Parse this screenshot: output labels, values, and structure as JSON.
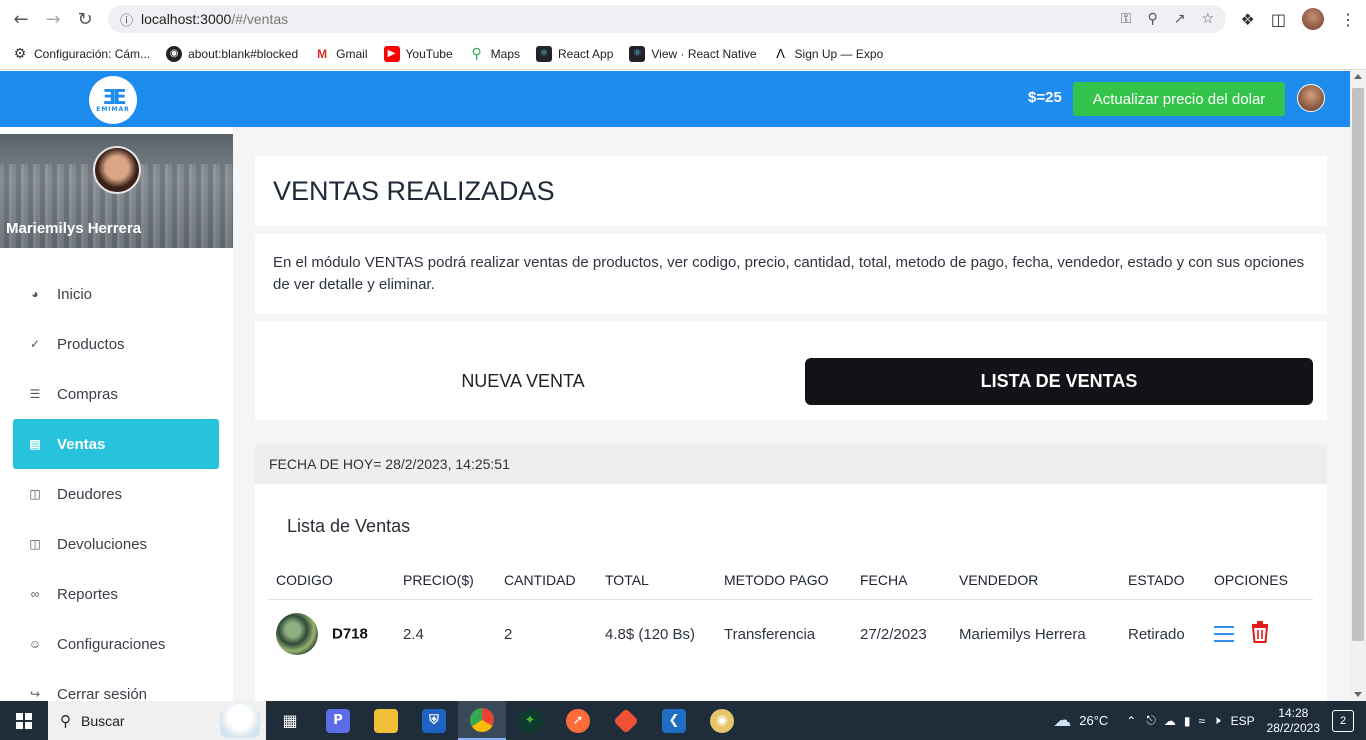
{
  "browser": {
    "url_host": "localhost:3000",
    "url_path": "/#/ventas",
    "bookmarks": [
      {
        "label": "Configuración: Cám...",
        "icon": "gear-icon"
      },
      {
        "label": "about:blank#blocked",
        "icon": "globe-icon"
      },
      {
        "label": "Gmail",
        "icon": "gmail-icon"
      },
      {
        "label": "YouTube",
        "icon": "youtube-icon"
      },
      {
        "label": "Maps",
        "icon": "maps-icon"
      },
      {
        "label": "React App",
        "icon": "react-icon"
      },
      {
        "label": "View · React Native",
        "icon": "react-icon"
      },
      {
        "label": "Sign Up — Expo",
        "icon": "expo-icon"
      }
    ]
  },
  "header": {
    "logo_mark": "ƎE",
    "logo_text": "EMIMAR",
    "rate": "$=25",
    "update_button": "Actualizar precio del dolar",
    "brand_color": "#1e8bef",
    "button_color": "#34c34b"
  },
  "sidebar": {
    "user_name": "Mariemilys Herrera",
    "items": [
      {
        "label": "Inicio",
        "icon": "dashboard-icon"
      },
      {
        "label": "Productos",
        "icon": "check-circle-icon"
      },
      {
        "label": "Compras",
        "icon": "list-icon"
      },
      {
        "label": "Ventas",
        "icon": "document-icon",
        "active": true
      },
      {
        "label": "Deudores",
        "icon": "columns-icon"
      },
      {
        "label": "Devoluciones",
        "icon": "book-icon"
      },
      {
        "label": "Reportes",
        "icon": "link-icon"
      },
      {
        "label": "Configuraciones",
        "icon": "users-icon"
      },
      {
        "label": "Cerrar sesión",
        "icon": "logout-icon"
      }
    ],
    "active_color": "#27c2dc"
  },
  "main": {
    "title": "VENTAS REALIZADAS",
    "description": "En el módulo VENTAS podrá realizar ventas de productos, ver codigo, precio, cantidad, total, metodo de pago, fecha, vendedor, estado y con sus opciones de ver detalle y eliminar.",
    "tab_new": "NUEVA VENTA",
    "tab_list": "LISTA DE VENTAS",
    "date_label": "FECHA DE HOY= 28/2/2023, 14:25:51",
    "list_title": "Lista de Ventas",
    "columns": [
      "CODIGO",
      "PRECIO($)",
      "CANTIDAD",
      "TOTAL",
      "METODO PAGO",
      "FECHA",
      "VENDEDOR",
      "ESTADO",
      "OPCIONES"
    ],
    "rows": [
      {
        "codigo": "D718",
        "precio": "2.4",
        "cantidad": "2",
        "total": "4.8$ (120 Bs)",
        "metodo": "Transferencia",
        "fecha": "27/2/2023",
        "vendedor": "Mariemilys Herrera",
        "estado": "Retirado"
      }
    ]
  },
  "taskbar": {
    "search_label": "Buscar",
    "temperature": "26°C",
    "language": "ESP",
    "time": "14:28",
    "date": "28/2/2023",
    "notifications": "2"
  }
}
